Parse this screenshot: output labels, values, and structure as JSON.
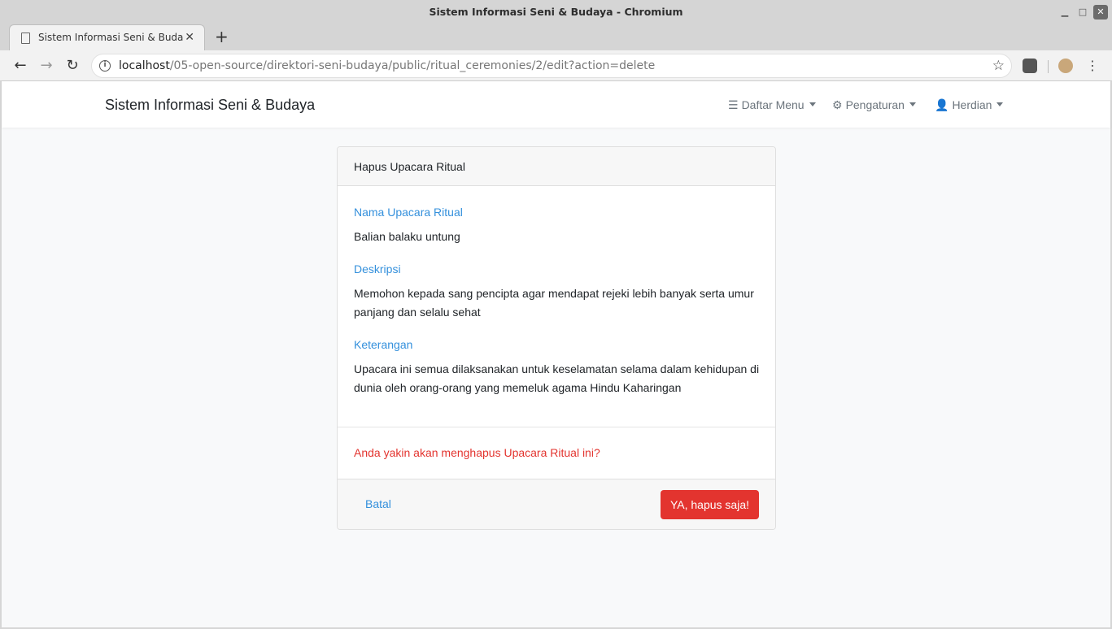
{
  "window": {
    "title": "Sistem Informasi Seni & Budaya - Chromium"
  },
  "tab": {
    "title": "Sistem Informasi Seni & Budaya",
    "close": "✕",
    "new_tab": "+"
  },
  "toolbar": {
    "back": "←",
    "forward": "→",
    "reload": "↻",
    "url_host": "localhost",
    "url_path": "/05-open-source/direktori-seni-budaya/public/ritual_ceremonies/2/edit?action=delete",
    "star": "☆",
    "menu": "⋮"
  },
  "navbar": {
    "brand": "Sistem Informasi Seni & Budaya",
    "menu_label": "Daftar Menu",
    "settings_label": "Pengaturan",
    "user_label": "Herdian"
  },
  "card": {
    "header": "Hapus Upacara Ritual",
    "fields": [
      {
        "label": "Nama Upacara Ritual",
        "value": "Balian balaku untung"
      },
      {
        "label": "Deskripsi",
        "value": "Memohon kepada sang pencipta agar mendapat rejeki lebih banyak serta umur panjang dan selalu sehat"
      },
      {
        "label": "Keterangan",
        "value": "Upacara ini semua dilaksanakan untuk keselamatan selama dalam kehidupan di dunia oleh orang-orang yang memeluk agama Hindu Kaharingan"
      }
    ],
    "confirm_text": "Anda yakin akan menghapus Upacara Ritual ini?",
    "cancel_label": "Batal",
    "delete_label": "YA, hapus saja!"
  },
  "colors": {
    "link": "#3490dc",
    "danger": "#e3342f",
    "page_bg": "#f8f9fa"
  }
}
